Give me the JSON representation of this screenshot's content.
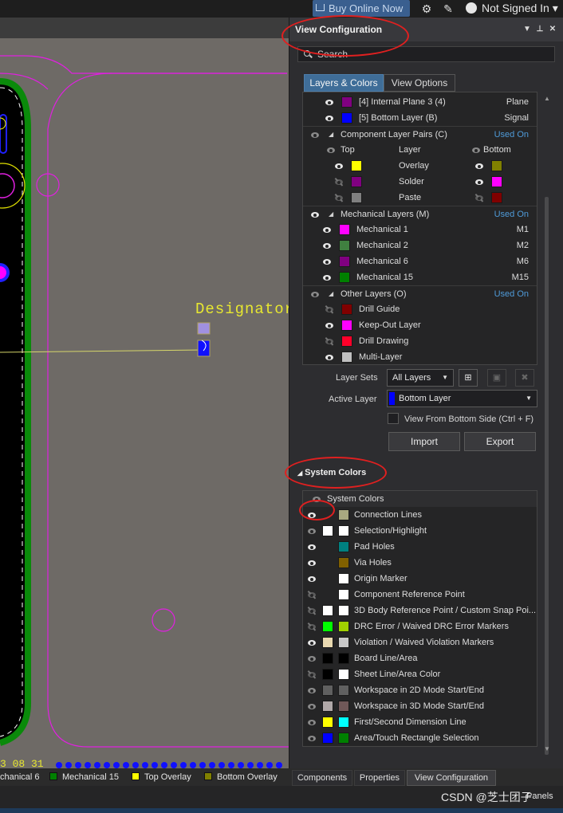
{
  "topbar": {
    "buy_label": "Buy Online Now",
    "user_label": "Not Signed In",
    "user_arrow": "▾"
  },
  "canvas": {
    "designator_text": "Designator",
    "bottom_text": "3 08 31"
  },
  "panel": {
    "title": "View Configuration",
    "search_placeholder": "Search",
    "tabs": [
      "Layers & Colors",
      "View Options"
    ],
    "layer_rows": [
      {
        "label": "[4] Internal Plane 3 (4)",
        "right": "Plane",
        "color": "#800080"
      },
      {
        "label": "[5] Bottom Layer (B)",
        "right": "Signal",
        "color": "#0000ff"
      }
    ],
    "component_pairs": {
      "title": "Component Layer Pairs (C)",
      "used_on": "Used On",
      "col_top": "Top",
      "col_layer": "Layer",
      "col_bottom": "Bottom",
      "rows": [
        {
          "layer": "Overlay",
          "top_color": "#ffff00",
          "bottom_color": "#808000"
        },
        {
          "layer": "Solder",
          "top_color": "#800080",
          "bottom_color": "#ff00ff"
        },
        {
          "layer": "Paste",
          "top_color": "#808080",
          "bottom_color": "#800000"
        }
      ]
    },
    "mechanical": {
      "title": "Mechanical Layers (M)",
      "used_on": "Used On",
      "rows": [
        {
          "label": "Mechanical 1",
          "short": "M1",
          "color": "#ff00ff"
        },
        {
          "label": "Mechanical 2",
          "short": "M2",
          "color": "#408040"
        },
        {
          "label": "Mechanical 6",
          "short": "M6",
          "color": "#800080"
        },
        {
          "label": "Mechanical 15",
          "short": "M15",
          "color": "#008000"
        }
      ]
    },
    "other": {
      "title": "Other Layers (O)",
      "used_on": "Used On",
      "rows": [
        {
          "label": "Drill Guide",
          "color": "#800000"
        },
        {
          "label": "Keep-Out Layer",
          "color": "#ff00ff"
        },
        {
          "label": "Drill Drawing",
          "color": "#ff002a"
        },
        {
          "label": "Multi-Layer",
          "color": "#c0c0c0"
        }
      ]
    },
    "layer_sets_label": "Layer Sets",
    "layer_sets_value": "All Layers",
    "active_layer_label": "Active Layer",
    "active_layer_value": "Bottom Layer",
    "active_layer_color": "#0000ff",
    "view_from_bottom": "View From Bottom Side (Ctrl + F)",
    "import_label": "Import",
    "export_label": "Export",
    "system_colors_section": "System Colors",
    "system_colors_header": "System Colors",
    "system_rows": [
      {
        "label": "Connection Lines",
        "c1": "",
        "c2": "#a8a880",
        "eye": "on"
      },
      {
        "label": "Selection/Highlight",
        "c1": "#ffffff",
        "c2": "#ffffff",
        "eye": "dim"
      },
      {
        "label": "Pad Holes",
        "c1": "",
        "c2": "#008080",
        "eye": "on"
      },
      {
        "label": "Via Holes",
        "c1": "",
        "c2": "#806000",
        "eye": "on"
      },
      {
        "label": "Origin Marker",
        "c1": "",
        "c2": "#ffffff",
        "eye": "on"
      },
      {
        "label": "Component Reference Point",
        "c1": "",
        "c2": "#ffffff",
        "eye": "off"
      },
      {
        "label": "3D Body Reference Point / Custom Snap Poi...",
        "c1": "#ffffff",
        "c2": "#ffffff",
        "eye": "off"
      },
      {
        "label": "DRC Error / Waived DRC Error Markers",
        "c1": "#00ff00",
        "c2": "#a0d000",
        "eye": "off"
      },
      {
        "label": "Violation / Waived Violation Markers",
        "c1": "#e8d8b0",
        "c2": "#c8c8c8",
        "eye": "on"
      },
      {
        "label": "Board Line/Area",
        "c1": "#000000",
        "c2": "#000000",
        "eye": "dim"
      },
      {
        "label": "Sheet Line/Area Color",
        "c1": "#000000",
        "c2": "#ffffff",
        "eye": "off"
      },
      {
        "label": "Workspace in 2D Mode Start/End",
        "c1": "#606060",
        "c2": "#606060",
        "eye": "dim"
      },
      {
        "label": "Workspace in 3D Mode Start/End",
        "c1": "#b0a8a8",
        "c2": "#705858",
        "eye": "dim"
      },
      {
        "label": "First/Second Dimension Line",
        "c1": "#ffff00",
        "c2": "#00ffff",
        "eye": "dim"
      },
      {
        "label": "Area/Touch Rectangle Selection",
        "c1": "#0000ff",
        "c2": "#008000",
        "eye": "dim"
      }
    ]
  },
  "bottom_tabs": [
    "Components",
    "Properties",
    "View Configuration"
  ],
  "layer_tabs": [
    {
      "label": "chanical 6",
      "color": "#800080"
    },
    {
      "label": "Mechanical 15",
      "color": "#008000"
    },
    {
      "label": "Top Overlay",
      "color": "#ffff00"
    },
    {
      "label": "Bottom Overlay",
      "color": "#808000"
    }
  ],
  "watermark": "CSDN @芝士团子",
  "panels_label": "Panels"
}
